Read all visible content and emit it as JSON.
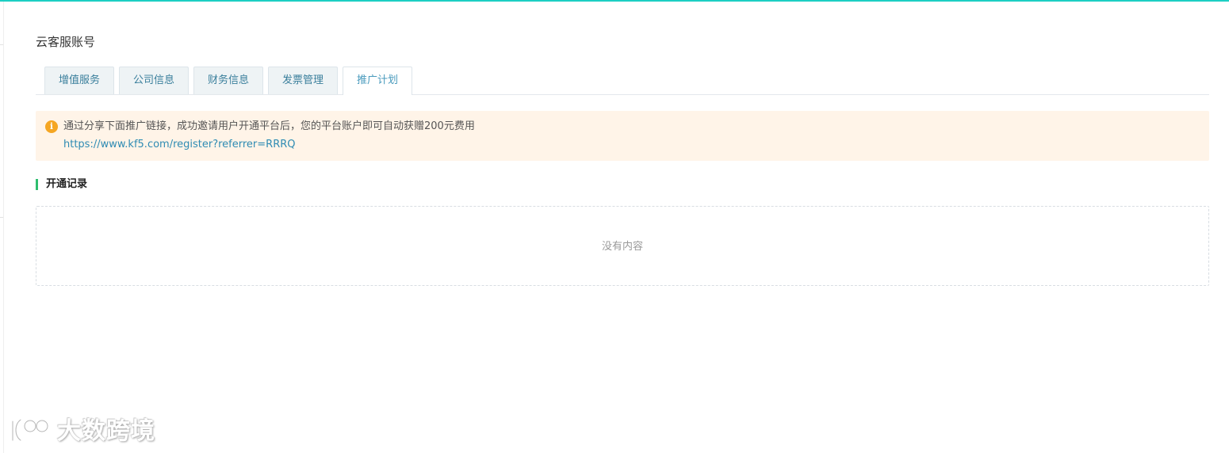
{
  "page": {
    "title": "云客服账号"
  },
  "tabs": [
    {
      "label": "增值服务",
      "active": false
    },
    {
      "label": "公司信息",
      "active": false
    },
    {
      "label": "财务信息",
      "active": false
    },
    {
      "label": "发票管理",
      "active": false
    },
    {
      "label": "推广计划",
      "active": true
    }
  ],
  "notice": {
    "icon": "info-icon",
    "icon_glyph": "i",
    "text": "通过分享下面推广链接，成功邀请用户开通平台后，您的平台账户即可自动获赠200元费用",
    "link": "https://www.kf5.com/register?referrer=RRRQ"
  },
  "records": {
    "title": "开通记录",
    "empty_text": "没有内容"
  },
  "watermark": {
    "text": "大数跨境"
  },
  "colors": {
    "top_accent": "#1ccfc3",
    "notice_bg": "#fff4e8",
    "notice_icon": "#f5a623",
    "link": "#2e8bb3",
    "section_bar": "#2ebd6e",
    "tab_bg": "#eef3f5",
    "tab_text": "#3a7f9c"
  }
}
